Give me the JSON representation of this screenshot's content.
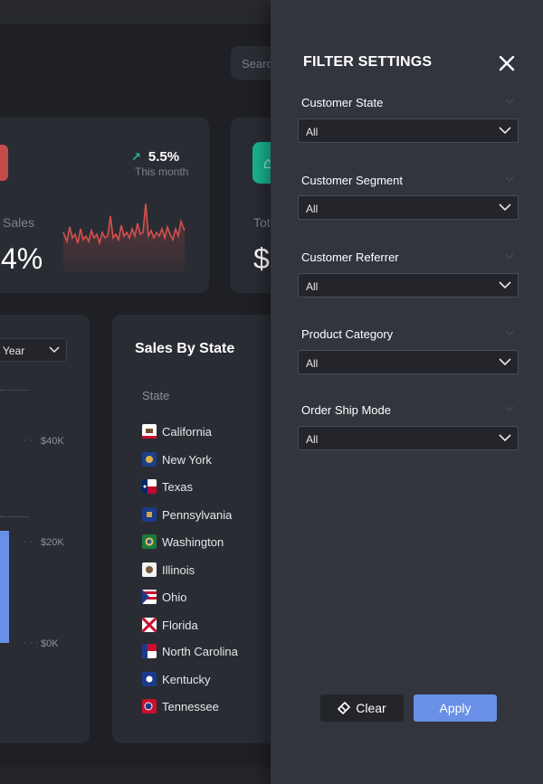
{
  "dashboard": {
    "search_placeholder": "Search",
    "kpi1": {
      "trend_value": "5.5%",
      "trend_sub": "This month",
      "label": "Sales",
      "value": "4%",
      "accent": "#c34b4b"
    },
    "kpi2": {
      "label": "Tota",
      "value": "$",
      "accent": "#19b391"
    },
    "line_card": {
      "period_select": "Year",
      "ticks": [
        "$40K",
        "$20K",
        "$0K"
      ],
      "bar_color": "#6a8fe6"
    },
    "sales_by_state": {
      "title": "Sales By State",
      "column_header": "State",
      "states": [
        {
          "name": "California",
          "flag_icon": "california-flag-icon"
        },
        {
          "name": "New York",
          "flag_icon": "new-york-flag-icon"
        },
        {
          "name": "Texas",
          "flag_icon": "texas-flag-icon"
        },
        {
          "name": "Pennsylvania",
          "flag_icon": "pennsylvania-flag-icon"
        },
        {
          "name": "Washington",
          "flag_icon": "washington-flag-icon"
        },
        {
          "name": "Illinois",
          "flag_icon": "illinois-flag-icon"
        },
        {
          "name": "Ohio",
          "flag_icon": "ohio-flag-icon"
        },
        {
          "name": "Florida",
          "flag_icon": "florida-flag-icon"
        },
        {
          "name": "North Carolina",
          "flag_icon": "north-carolina-flag-icon"
        },
        {
          "name": "Kentucky",
          "flag_icon": "kentucky-flag-icon"
        },
        {
          "name": "Tennessee",
          "flag_icon": "tennessee-flag-icon"
        }
      ]
    }
  },
  "filter_panel": {
    "title": "FILTER SETTINGS",
    "close_icon": "close-icon",
    "filters": [
      {
        "label": "Customer State",
        "value": "All"
      },
      {
        "label": "Customer Segment",
        "value": "All"
      },
      {
        "label": "Customer Referrer",
        "value": "All"
      },
      {
        "label": "Product Category",
        "value": "All"
      },
      {
        "label": "Order Ship Mode",
        "value": "All"
      }
    ],
    "clear_label": "Clear",
    "clear_icon": "eraser-icon",
    "apply_label": "Apply",
    "apply_color": "#6a8fe6",
    "background": "#32353d"
  }
}
